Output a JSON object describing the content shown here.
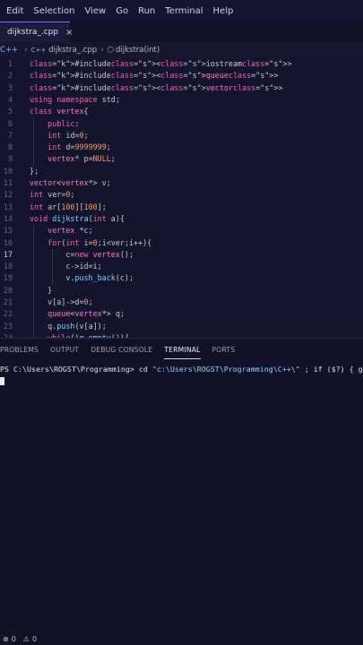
{
  "menu": [
    "Edit",
    "Selection",
    "View",
    "Go",
    "Run",
    "Terminal",
    "Help"
  ],
  "tab": {
    "label": "dijkstra_.cpp",
    "close": "×"
  },
  "breadcrumb": {
    "lang": "C++",
    "sep": "›",
    "file": "dijkstra_.cpp",
    "symbol": "dijkstra(int)"
  },
  "editor": {
    "active_line": 17,
    "lines": [
      {
        "n": "1",
        "code": "#include<iostream>"
      },
      {
        "n": "2",
        "code": "#include<queue>"
      },
      {
        "n": "3",
        "code": "#include<vector>"
      },
      {
        "n": "4",
        "code": "using namespace std;"
      },
      {
        "n": "5",
        "code": "class vertex{"
      },
      {
        "n": "6",
        "code": "    public:"
      },
      {
        "n": "7",
        "code": "    int id=0;"
      },
      {
        "n": "8",
        "code": "    int d=9999999;"
      },
      {
        "n": "9",
        "code": "    vertex* p=NULL;"
      },
      {
        "n": "10",
        "code": "};"
      },
      {
        "n": "11",
        "code": "vector<vertex*> v;"
      },
      {
        "n": "12",
        "code": "int ver=0;"
      },
      {
        "n": "13",
        "code": "int ar[100][100];"
      },
      {
        "n": "14",
        "code": "void dijkstra(int a){"
      },
      {
        "n": "15",
        "code": "    vertex *c;"
      },
      {
        "n": "16",
        "code": "    for(int i=0;i<ver;i++){"
      },
      {
        "n": "17",
        "code": "        c=new vertex();"
      },
      {
        "n": "18",
        "code": "        c->id=i;"
      },
      {
        "n": "19",
        "code": "        v.push_back(c);"
      },
      {
        "n": "20",
        "code": "    }"
      },
      {
        "n": "21",
        "code": "    v[a]->d=0;"
      },
      {
        "n": "22",
        "code": "    queue<vertex*> q;"
      },
      {
        "n": "23",
        "code": "    q.push(v[a]);"
      },
      {
        "n": "24",
        "code": "    while(!q.empty()){"
      }
    ]
  },
  "panel": {
    "tabs": [
      "PROBLEMS",
      "OUTPUT",
      "DEBUG CONSOLE",
      "TERMINAL",
      "PORTS"
    ],
    "active": "TERMINAL"
  },
  "terminal": {
    "prompt": "PS C:\\Users\\ROGST\\Programming> ",
    "command": "cd ",
    "path": "\"c:\\Users\\ROGST\\Programming\\C++\\\"",
    "rest": " ; if ($?) { g++"
  },
  "status": {
    "errors": "0",
    "warnings": "0"
  }
}
